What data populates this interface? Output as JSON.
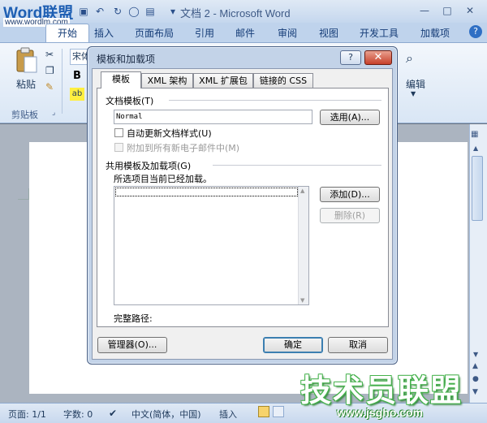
{
  "app": {
    "logo_text": "Word联盟",
    "logo_site": "www.wordlm.com",
    "window_title": "文档 2 - Microsoft Word",
    "window_controls": {
      "minimize": "—",
      "maximize": "□",
      "close": "✕",
      "help": "?"
    }
  },
  "ribbon": {
    "tabs": [
      "开始",
      "插入",
      "页面布局",
      "引用",
      "邮件",
      "审阅",
      "视图",
      "开发工具",
      "加载项"
    ],
    "active_tab": "开始",
    "paste_label": "粘贴",
    "clipboard_group": "剪贴板",
    "font_name": "宋体",
    "bold_label": "B",
    "edit_label": "编辑"
  },
  "dialog": {
    "title": "模板和加载项",
    "help_label": "?",
    "close_label": "✕",
    "tabs": [
      "模板",
      "XML 架构",
      "XML 扩展包",
      "链接的 CSS"
    ],
    "active_tab": "模板",
    "document_template_label": "文档模板(T)",
    "document_template_value": "Normal",
    "attach_button": "选用(A)...",
    "auto_update_label": "自动更新文档样式(U)",
    "auto_update_checked": false,
    "attach_email_label": "附加到所有新电子邮件中(M)",
    "attach_email_enabled": false,
    "global_templates_label": "共用模板及加载项(G)",
    "loaded_note": "所选项目当前已经加载。",
    "add_button": "添加(D)...",
    "remove_button": "删除(R)",
    "full_path_label": "完整路径:",
    "organizer_button": "管理器(O)...",
    "ok_button": "确定",
    "cancel_button": "取消"
  },
  "statusbar": {
    "page": "页面: 1/1",
    "words": "字数: 0",
    "language": "中文(简体，中国)",
    "mode": "插入"
  },
  "watermark": {
    "big": "技术员联盟",
    "small": "www.jsgho.com"
  },
  "colors": {
    "ribbon_bg": "#d9e6f5",
    "dialog_frame": "#c3d3e8",
    "close_red": "#c7402a",
    "watermark_green": "#46b24d"
  }
}
